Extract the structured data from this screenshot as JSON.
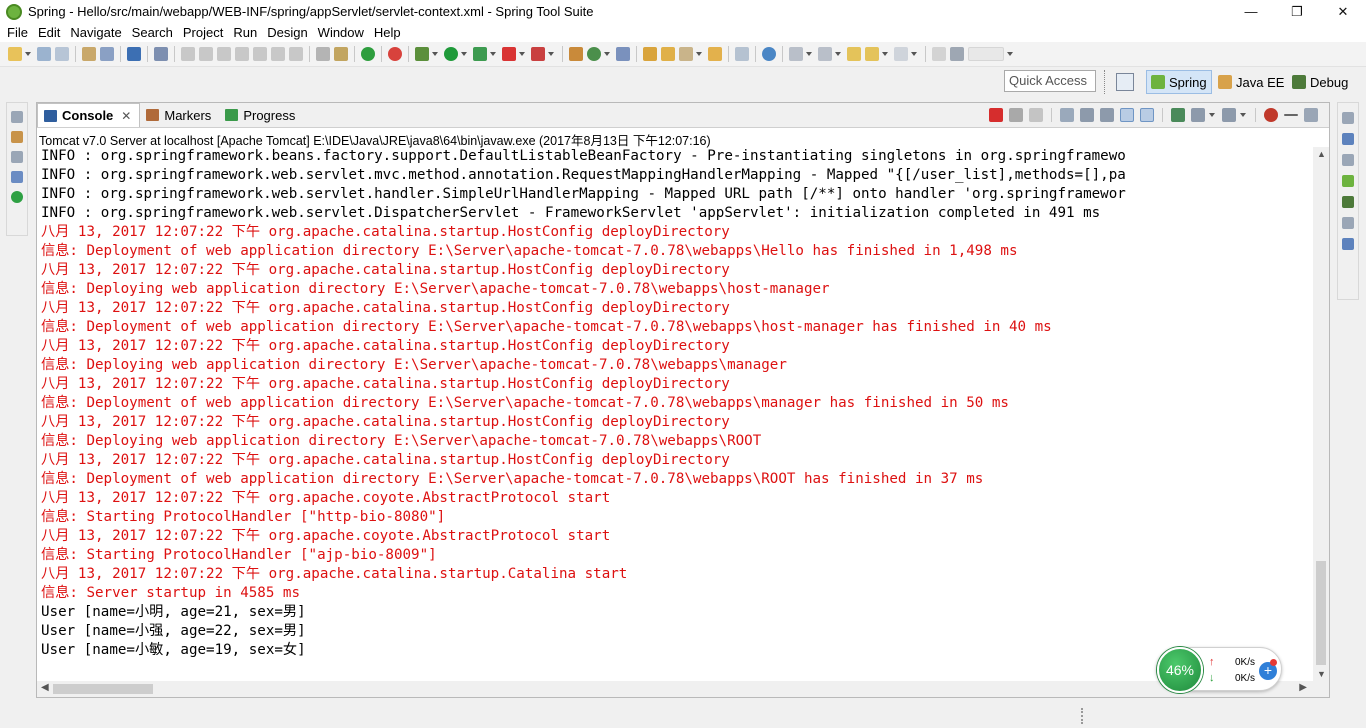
{
  "window": {
    "title": "Spring - Hello/src/main/webapp/WEB-INF/spring/appServlet/servlet-context.xml - Spring Tool Suite",
    "minimize": "—",
    "maximize": "❐",
    "close": "✕"
  },
  "menu": [
    "File",
    "Edit",
    "Navigate",
    "Search",
    "Project",
    "Run",
    "Design",
    "Window",
    "Help"
  ],
  "quick_access": {
    "placeholder": "Quick Access"
  },
  "perspectives": [
    {
      "label": "Spring",
      "active": true
    },
    {
      "label": "Java EE",
      "active": false
    },
    {
      "label": "Debug",
      "active": false
    }
  ],
  "view": {
    "tabs": [
      {
        "label": "Console",
        "active": true,
        "icon": "console-icon"
      },
      {
        "label": "Markers",
        "active": false,
        "icon": "markers-icon"
      },
      {
        "label": "Progress",
        "active": false,
        "icon": "progress-icon"
      }
    ],
    "launch_description": "Tomcat v7.0 Server at localhost [Apache Tomcat] E:\\IDE\\Java\\JRE\\java8\\64\\bin\\javaw.exe (2017年8月13日 下午12:07:16)"
  },
  "console_lines": [
    {
      "text": "INFO : org.springframework.beans.factory.support.DefaultListableBeanFactory - Pre-instantiating singletons in org.springframewo",
      "level": "info"
    },
    {
      "text": "INFO : org.springframework.web.servlet.mvc.method.annotation.RequestMappingHandlerMapping - Mapped \"{[/user_list],methods=[],pa",
      "level": "info"
    },
    {
      "text": "INFO : org.springframework.web.servlet.handler.SimpleUrlHandlerMapping - Mapped URL path [/**] onto handler 'org.springframewor",
      "level": "info"
    },
    {
      "text": "INFO : org.springframework.web.servlet.DispatcherServlet - FrameworkServlet 'appServlet': initialization completed in 491 ms",
      "level": "info"
    },
    {
      "text": "八月 13, 2017 12:07:22 下午 org.apache.catalina.startup.HostConfig deployDirectory",
      "level": "err"
    },
    {
      "text": "信息: Deployment of web application directory E:\\Server\\apache-tomcat-7.0.78\\webapps\\Hello has finished in 1,498 ms",
      "level": "err"
    },
    {
      "text": "八月 13, 2017 12:07:22 下午 org.apache.catalina.startup.HostConfig deployDirectory",
      "level": "err"
    },
    {
      "text": "信息: Deploying web application directory E:\\Server\\apache-tomcat-7.0.78\\webapps\\host-manager",
      "level": "err"
    },
    {
      "text": "八月 13, 2017 12:07:22 下午 org.apache.catalina.startup.HostConfig deployDirectory",
      "level": "err"
    },
    {
      "text": "信息: Deployment of web application directory E:\\Server\\apache-tomcat-7.0.78\\webapps\\host-manager has finished in 40 ms",
      "level": "err"
    },
    {
      "text": "八月 13, 2017 12:07:22 下午 org.apache.catalina.startup.HostConfig deployDirectory",
      "level": "err"
    },
    {
      "text": "信息: Deploying web application directory E:\\Server\\apache-tomcat-7.0.78\\webapps\\manager",
      "level": "err"
    },
    {
      "text": "八月 13, 2017 12:07:22 下午 org.apache.catalina.startup.HostConfig deployDirectory",
      "level": "err"
    },
    {
      "text": "信息: Deployment of web application directory E:\\Server\\apache-tomcat-7.0.78\\webapps\\manager has finished in 50 ms",
      "level": "err"
    },
    {
      "text": "八月 13, 2017 12:07:22 下午 org.apache.catalina.startup.HostConfig deployDirectory",
      "level": "err"
    },
    {
      "text": "信息: Deploying web application directory E:\\Server\\apache-tomcat-7.0.78\\webapps\\ROOT",
      "level": "err"
    },
    {
      "text": "八月 13, 2017 12:07:22 下午 org.apache.catalina.startup.HostConfig deployDirectory",
      "level": "err"
    },
    {
      "text": "信息: Deployment of web application directory E:\\Server\\apache-tomcat-7.0.78\\webapps\\ROOT has finished in 37 ms",
      "level": "err"
    },
    {
      "text": "八月 13, 2017 12:07:22 下午 org.apache.coyote.AbstractProtocol start",
      "level": "err"
    },
    {
      "text": "信息: Starting ProtocolHandler [\"http-bio-8080\"]",
      "level": "err"
    },
    {
      "text": "八月 13, 2017 12:07:22 下午 org.apache.coyote.AbstractProtocol start",
      "level": "err"
    },
    {
      "text": "信息: Starting ProtocolHandler [\"ajp-bio-8009\"]",
      "level": "err"
    },
    {
      "text": "八月 13, 2017 12:07:22 下午 org.apache.catalina.startup.Catalina start",
      "level": "err"
    },
    {
      "text": "信息: Server startup in 4585 ms",
      "level": "err"
    },
    {
      "text": "User [name=小明, age=21, sex=男]",
      "level": "info"
    },
    {
      "text": "User [name=小强, age=22, sex=男]",
      "level": "info"
    },
    {
      "text": "User [name=小敏, age=19, sex=女]",
      "level": "info"
    }
  ],
  "net_monitor": {
    "percent": "46%",
    "upload_rate": "0K/s",
    "download_rate": "0K/s",
    "add": "+"
  },
  "colors": {
    "info_text": "#000000",
    "stderr_text": "#dd1111",
    "spring_green": "#6db33f",
    "active_perspective": "#d4e5f7"
  }
}
